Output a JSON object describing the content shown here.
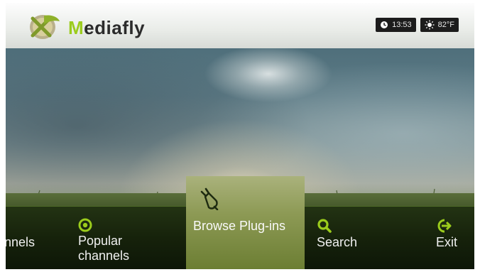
{
  "app": {
    "logo_text_accent": "M",
    "logo_text_rest": "ediafly"
  },
  "status": {
    "clock_icon": "clock-icon",
    "time": "13:53",
    "weather_icon": "sun-icon",
    "temperature": "82°F"
  },
  "menu": {
    "items": [
      {
        "label": "nnels",
        "icon": ""
      },
      {
        "label_line1": "Popular",
        "label_line2": "channels",
        "icon": "star-circle-icon"
      },
      {
        "label": "Browse Plug-ins",
        "icon": "plug-icon",
        "selected": true
      },
      {
        "label": "Search",
        "icon": "search-icon"
      },
      {
        "label": "Exit",
        "icon": "exit-arrow-icon"
      }
    ]
  },
  "colors": {
    "accent_green": "#9bcc1c",
    "selected_tile": "#8d9a55",
    "menu_bar": "#16220b"
  }
}
